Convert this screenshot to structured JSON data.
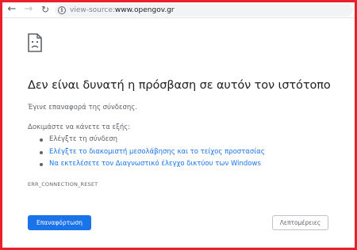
{
  "browser": {
    "back_icon": "arrow-left-icon",
    "forward_icon": "arrow-right-icon",
    "reload_icon": "reload-icon",
    "info_icon": "info-icon",
    "url_scheme": "view-source:",
    "url_host": "www.opengov.gr"
  },
  "error_page": {
    "icon": "sad-page-icon",
    "title": "Δεν είναι δυνατή η πρόσβαση σε αυτόν τον ιστότοπο",
    "subtitle": "Έγινε επαναφορά της σύνδεσης.",
    "try_heading": "Δοκιμάστε να κάνετε τα εξής:",
    "suggestions": [
      "Ελέγξτε τη σύνδεση",
      "Ελέγξτε το διακομιστή μεσολάβησης και το τείχος προστασίας",
      "Να εκτελέσετε τον Διαγνωστικό έλεγχο δικτύου των Windows"
    ],
    "error_code": "ERR_CONNECTION_RESET",
    "reload_label": "Επαναφόρτωση",
    "details_label": "Λεπτομέρειες"
  },
  "colors": {
    "accent": "#1a73e8",
    "frame": "#e8222d"
  }
}
